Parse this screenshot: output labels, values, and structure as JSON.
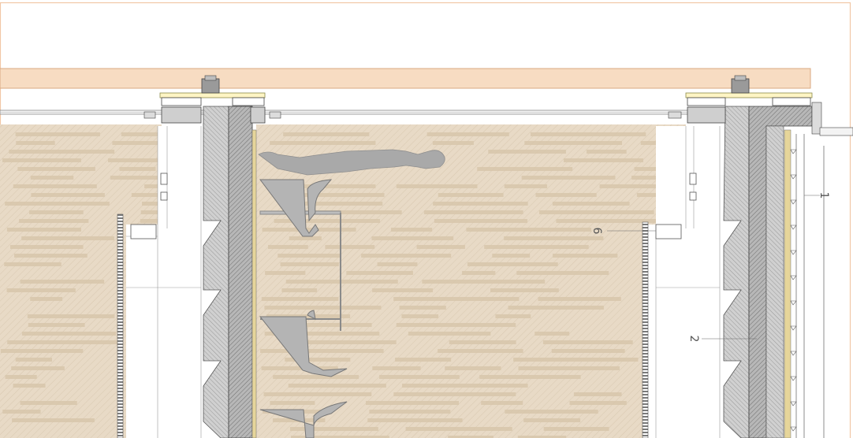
{
  "colors": {
    "paper": "#ffffff",
    "frame": "#f1c7a6",
    "timber_band": "#f7dcc2",
    "section_fill": "#e8dac6",
    "section_stripe": "#d7c6aa",
    "concrete": "#a7a7a7",
    "concrete_dark": "#7d7d7d",
    "glass": "#d9d9d9",
    "figure": "#a9a9a9",
    "line": "#5a5a5a",
    "insulation": "#e6d59a"
  },
  "icons": {
    "human_figure": "human-figure-icon",
    "chair": "chair-icon",
    "table": "table-icon"
  },
  "labels": {
    "marker_6": "6",
    "marker_2": "2",
    "marker_1": "1"
  }
}
